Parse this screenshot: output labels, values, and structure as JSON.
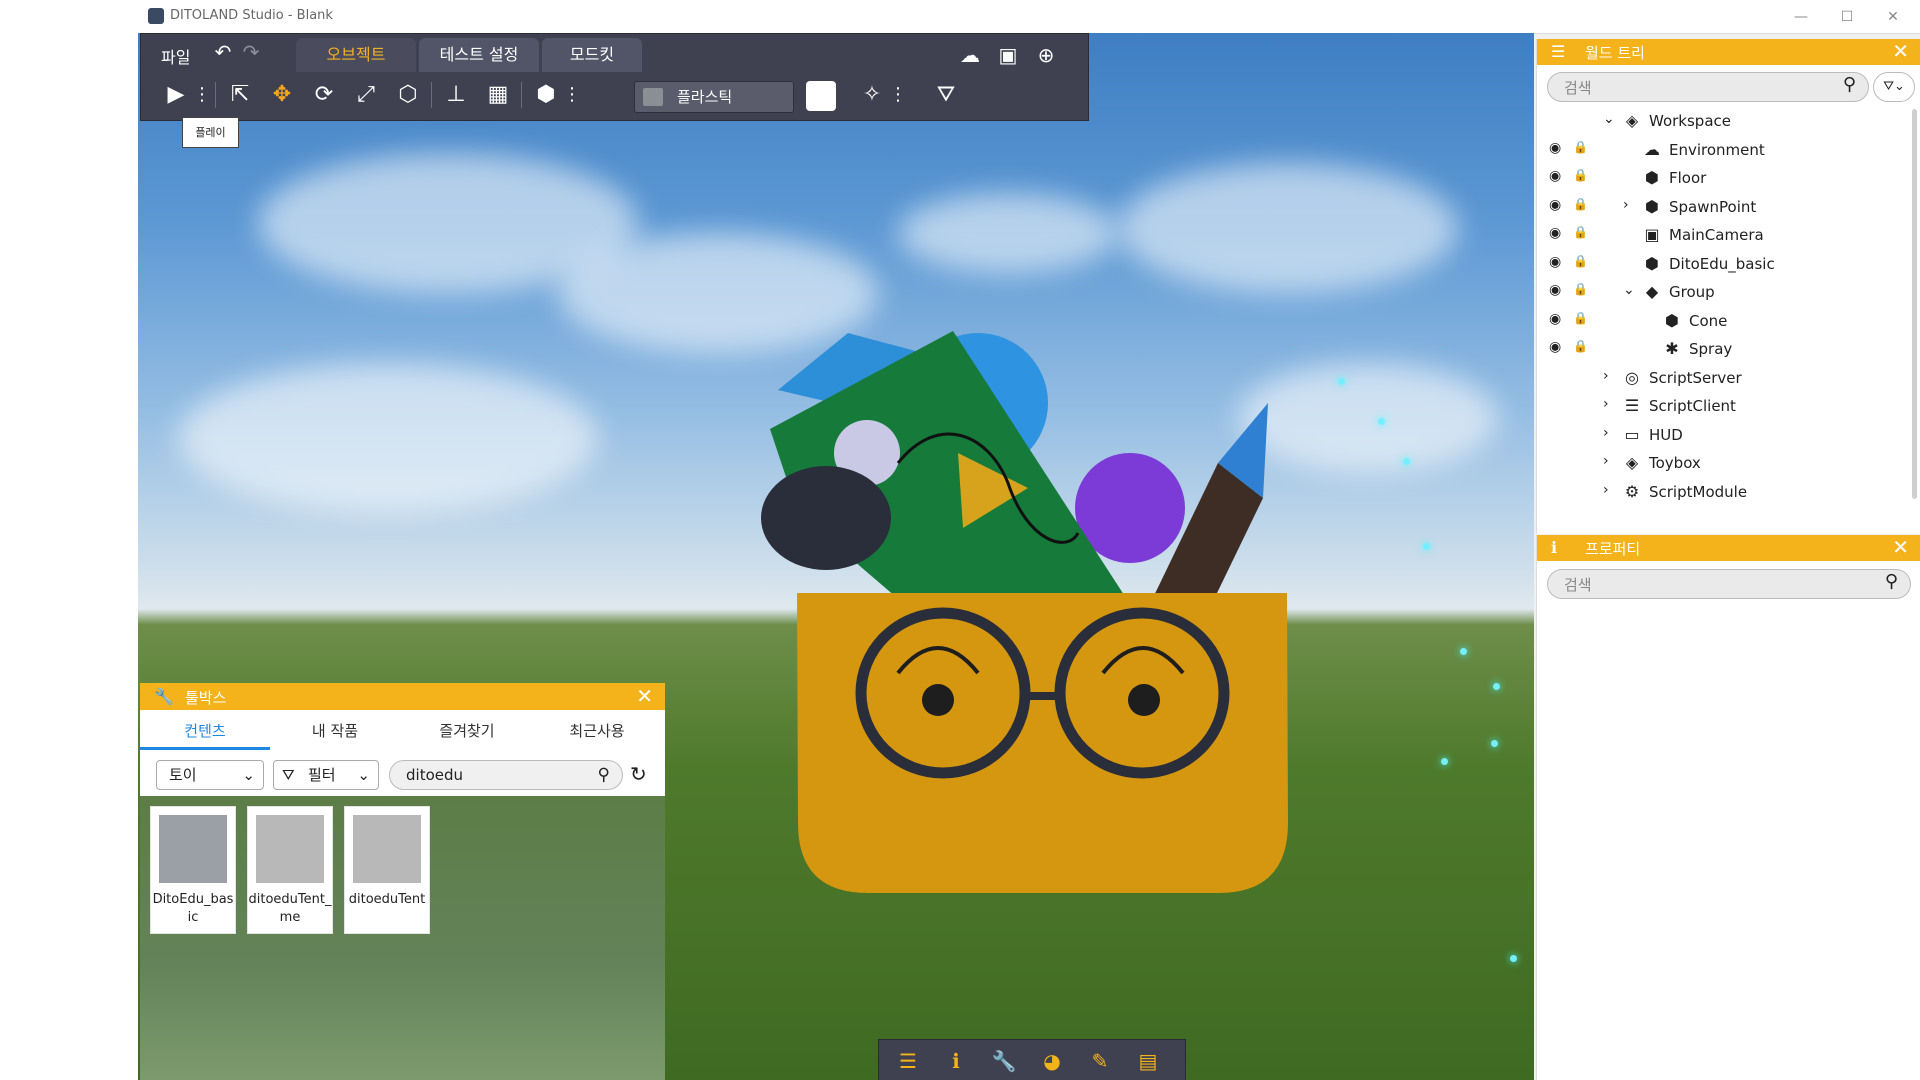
{
  "window": {
    "title": "DITOLAND Studio - Blank",
    "controls": [
      "—",
      "☐",
      "✕"
    ]
  },
  "menu": {
    "file": "파일",
    "undo_icon": "undo-icon",
    "redo_icon": "redo-icon",
    "tabs": [
      {
        "label": "오브젝트",
        "active": true
      },
      {
        "label": "테스트 설정",
        "active": false
      },
      {
        "label": "모드킷",
        "active": false
      }
    ],
    "right_icons": [
      "cloud-upload-icon",
      "save-icon",
      "new-file-icon"
    ]
  },
  "toolbar": {
    "material_label": "플라스틱",
    "color_value": "#ffffff",
    "play_tooltip": "플레이"
  },
  "toolbox": {
    "title": "툴박스",
    "tabs": [
      "컨텐츠",
      "내 작품",
      "즐겨찾기",
      "최근사용"
    ],
    "active_tab": 0,
    "category": "토이",
    "filter": "필터",
    "search_value": "ditoedu",
    "items": [
      {
        "name": "DitoEdu_basic",
        "thumb": "basket-thumbnail"
      },
      {
        "name": "ditoeduTent_me",
        "thumb": "tent-thumbnail"
      },
      {
        "name": "ditoeduTent",
        "thumb": "tent-red-dot-thumbnail"
      }
    ]
  },
  "world_tree": {
    "title": "월드 트리",
    "search_placeholder": "검색",
    "nodes": [
      {
        "name": "Workspace",
        "depth": 0,
        "expander": "open",
        "icon": "workspace-icon",
        "eye": false,
        "lock": "none"
      },
      {
        "name": "Environment",
        "depth": 1,
        "expander": "none",
        "icon": "environment-icon",
        "eye": true,
        "lock": "off"
      },
      {
        "name": "Floor",
        "depth": 1,
        "expander": "none",
        "icon": "cube-icon",
        "eye": true,
        "lock": "on"
      },
      {
        "name": "SpawnPoint",
        "depth": 1,
        "expander": "closed",
        "icon": "cube-icon",
        "eye": true,
        "lock": "off"
      },
      {
        "name": "MainCamera",
        "depth": 1,
        "expander": "none",
        "icon": "camera-icon",
        "eye": true,
        "lock": "off"
      },
      {
        "name": "DitoEdu_basic",
        "depth": 1,
        "expander": "none",
        "icon": "cube-icon",
        "eye": true,
        "lock": "off"
      },
      {
        "name": "Group",
        "depth": 1,
        "expander": "open",
        "icon": "group-icon",
        "eye": true,
        "lock": "off"
      },
      {
        "name": "Cone",
        "depth": 2,
        "expander": "none",
        "icon": "cube-icon",
        "eye": true,
        "lock": "off"
      },
      {
        "name": "Spray",
        "depth": 2,
        "expander": "none",
        "icon": "spray-icon",
        "eye": true,
        "lock": "off"
      },
      {
        "name": "ScriptServer",
        "depth": 0,
        "expander": "closed",
        "icon": "script-server-icon",
        "eye": false,
        "lock": "none"
      },
      {
        "name": "ScriptClient",
        "depth": 0,
        "expander": "closed",
        "icon": "script-client-icon",
        "eye": false,
        "lock": "none"
      },
      {
        "name": "HUD",
        "depth": 0,
        "expander": "closed",
        "icon": "hud-icon",
        "eye": false,
        "lock": "none"
      },
      {
        "name": "Toybox",
        "depth": 0,
        "expander": "closed",
        "icon": "toybox-icon",
        "eye": false,
        "lock": "none"
      },
      {
        "name": "ScriptModule",
        "depth": 0,
        "expander": "closed",
        "icon": "script-module-icon",
        "eye": false,
        "lock": "none"
      }
    ]
  },
  "properties": {
    "title": "프로퍼티",
    "search_placeholder": "검색"
  },
  "bottom_bar": {
    "icons": [
      "world-tree-icon",
      "info-icon",
      "toolbox-icon",
      "palette-icon",
      "script-edit-icon",
      "document-icon"
    ]
  },
  "colors": {
    "accent": "#f5b31b",
    "toolbar_bg": "#3f4151",
    "active_tab": "#f5b020",
    "toolbox_tab": "#1e88e5"
  }
}
